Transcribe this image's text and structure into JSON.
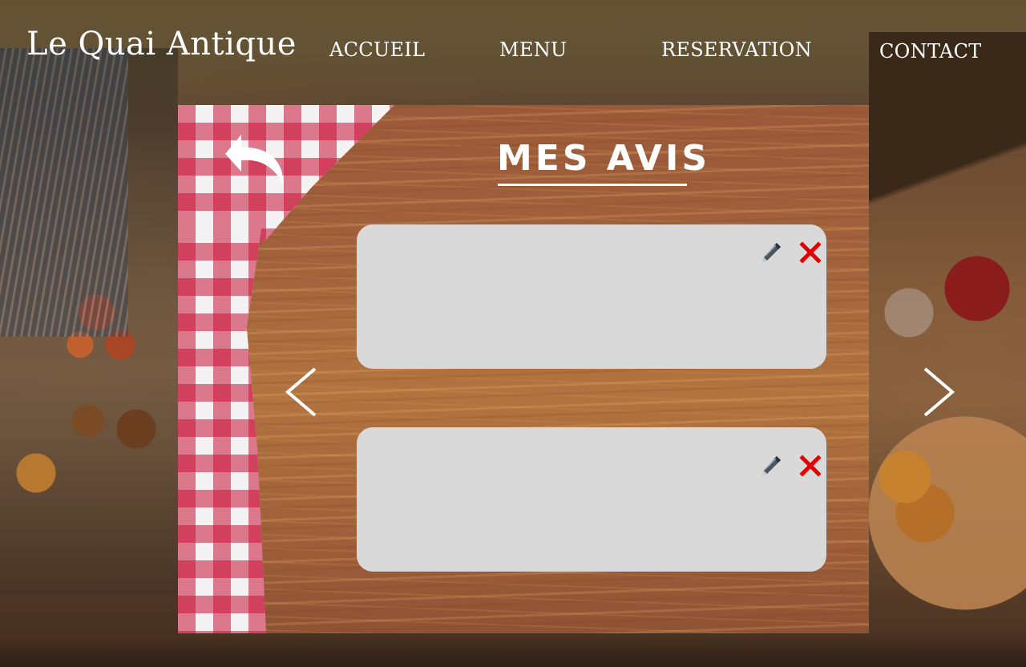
{
  "header": {
    "brand": "Le Quai Antique",
    "nav": {
      "home": "ACCUEIL",
      "menu": "MENU",
      "reservation": "RESERVATION",
      "contact": "CONTACT"
    }
  },
  "main": {
    "title": "MES AVIS",
    "reviews": [
      {
        "text": "",
        "actions": [
          "edit-pen-icon",
          "delete-cross-icon"
        ]
      },
      {
        "text": "",
        "actions": [
          "edit-pen-icon",
          "delete-cross-icon"
        ]
      }
    ],
    "icons": {
      "back": "back-arrow-icon",
      "previous": "chevron-left-icon",
      "next": "chevron-right-icon"
    }
  },
  "colors": {
    "delete_icon": "#e00000",
    "card_background": "#d9d9d9",
    "text": "#ffffff"
  }
}
